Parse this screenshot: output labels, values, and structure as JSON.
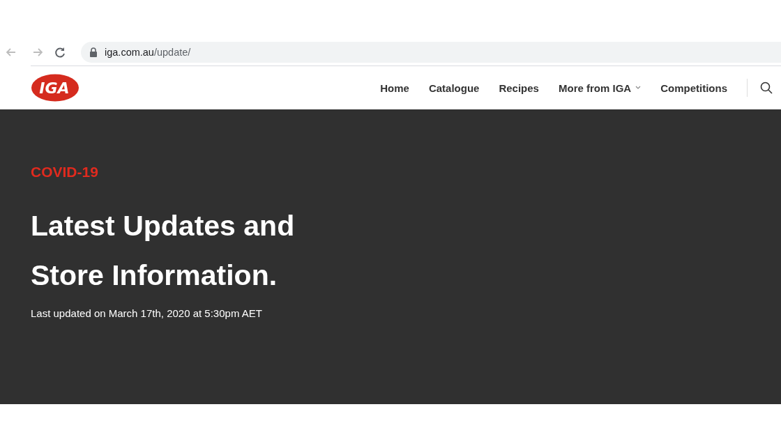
{
  "browser": {
    "url_host": "iga.com.au",
    "url_path": "/update/"
  },
  "header": {
    "logo_text": "IGA",
    "nav": [
      {
        "label": "Home",
        "dropdown": false
      },
      {
        "label": "Catalogue",
        "dropdown": false
      },
      {
        "label": "Recipes",
        "dropdown": false
      },
      {
        "label": "More from IGA",
        "dropdown": true
      },
      {
        "label": "Competitions",
        "dropdown": false
      }
    ]
  },
  "hero": {
    "eyebrow": "COVID-19",
    "title_lines": [
      "Latest Updates and",
      "Store Information."
    ],
    "updated": "Last updated on March 17th, 2020 at 5:30pm AET"
  }
}
